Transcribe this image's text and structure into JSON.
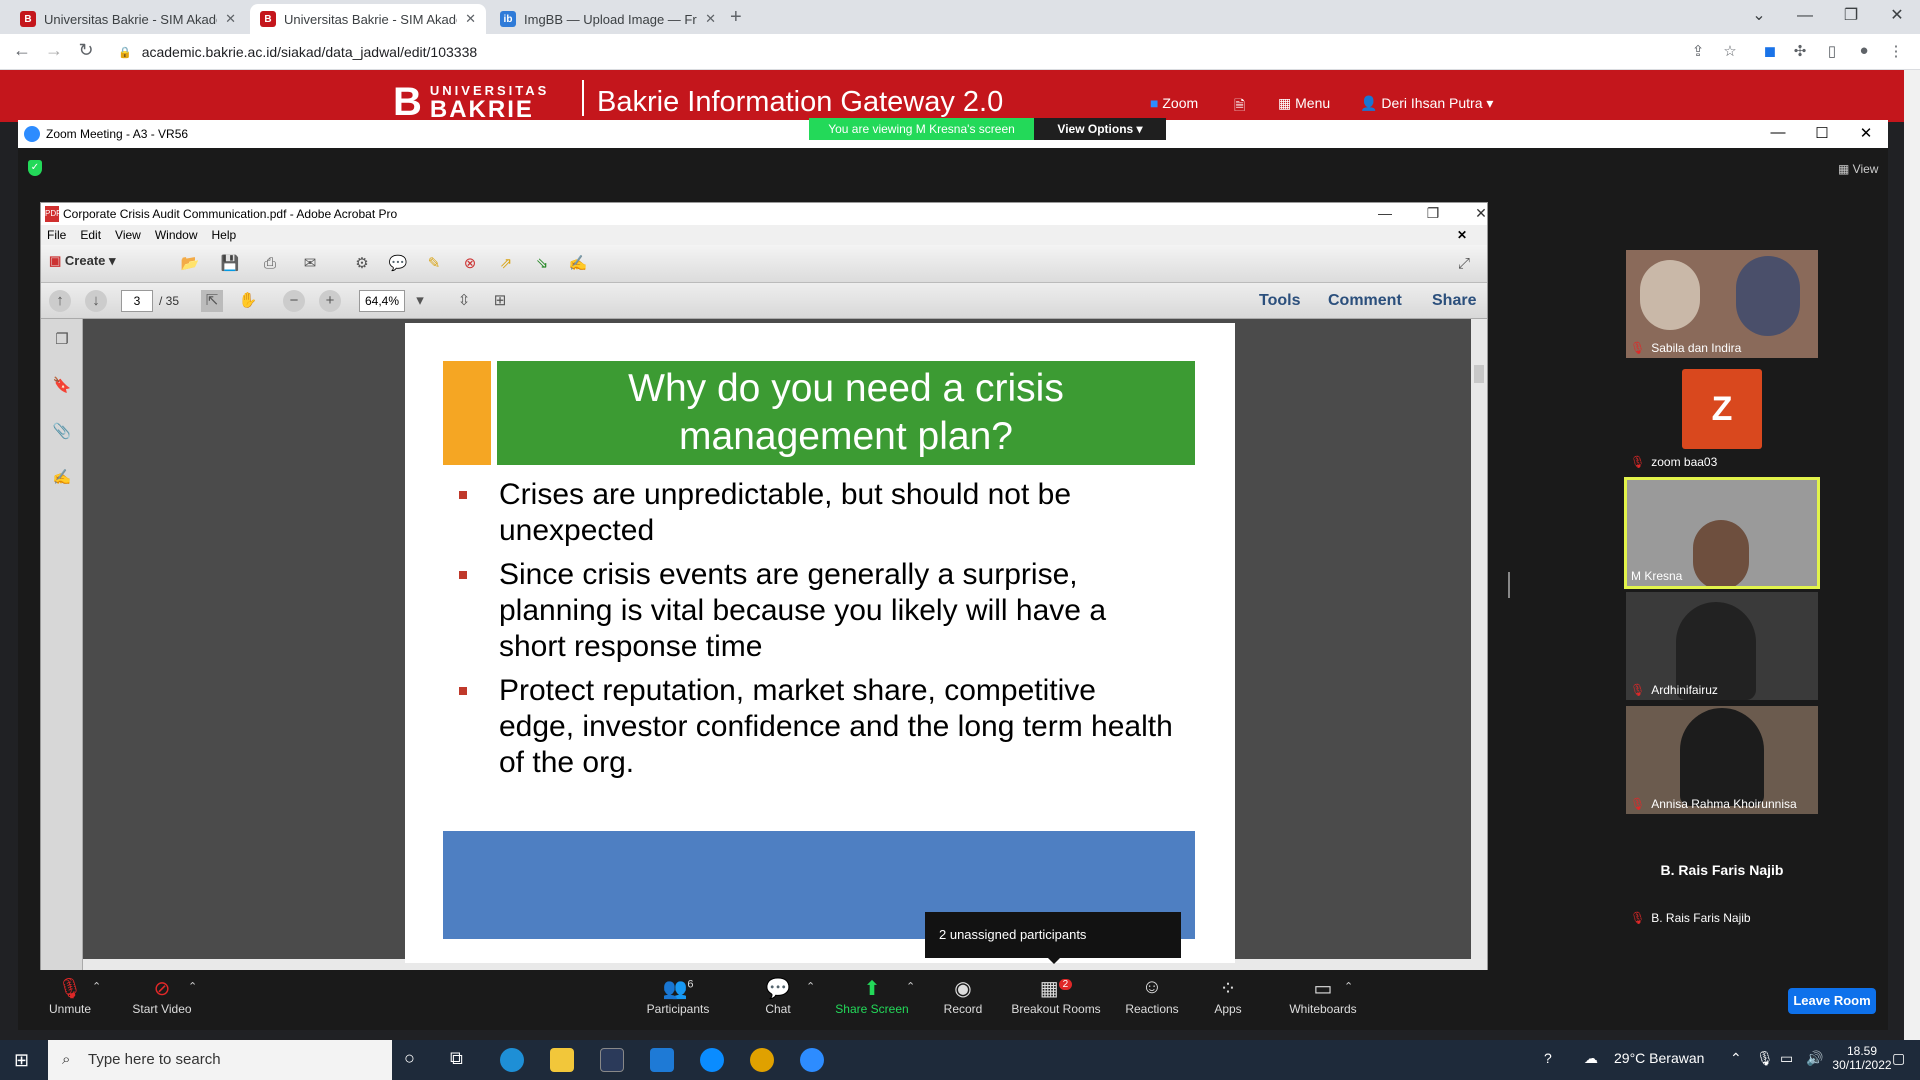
{
  "browser": {
    "tabs": [
      {
        "title": "Universitas Bakrie - SIM Akadem",
        "active": false
      },
      {
        "title": "Universitas Bakrie - SIM Akadem",
        "active": true
      },
      {
        "title": "ImgBB — Upload Image — Free",
        "active": false
      }
    ],
    "url": "academic.bakrie.ac.id/siakad/data_jadwal/edit/103338"
  },
  "site": {
    "logo_top": "UNIVERSITAS",
    "logo_bottom": "BAKRIE",
    "title": "Bakrie Information Gateway 2.0",
    "nav": {
      "zoom": "Zoom",
      "menu": "Menu",
      "user": "Deri Ihsan Putra"
    }
  },
  "zoom": {
    "window_title": "Zoom Meeting - A3 - VR56",
    "viewing_banner": "You are viewing M Kresna's screen",
    "view_options": "View Options",
    "view_label": "View",
    "tooltip": "2 unassigned participants",
    "participants": [
      {
        "name": "Sabila dan Indira",
        "kind": "video"
      },
      {
        "name": "zoom baa03",
        "kind": "avatar",
        "initial": "Z"
      },
      {
        "name": "M Kresna",
        "kind": "video",
        "active": true
      },
      {
        "name": "Ardhinifairuz",
        "kind": "video"
      },
      {
        "name": "Annisa Rahma Khoirunnisa",
        "kind": "video"
      },
      {
        "name": "B. Rais Faris Najib",
        "kind": "name",
        "display": "B. Rais Faris Najib"
      }
    ],
    "toolbar": {
      "unmute": "Unmute",
      "start_video": "Start Video",
      "participants": "Participants",
      "participants_count": "6",
      "chat": "Chat",
      "share_screen": "Share Screen",
      "record": "Record",
      "breakout_rooms": "Breakout Rooms",
      "breakout_badge": "2",
      "reactions": "Reactions",
      "apps": "Apps",
      "whiteboards": "Whiteboards",
      "leave_room": "Leave Room"
    }
  },
  "acrobat": {
    "title": "Corporate Crisis Audit Communication.pdf - Adobe Acrobat Pro",
    "menu": [
      "File",
      "Edit",
      "View",
      "Window",
      "Help"
    ],
    "create": "Create",
    "page": "3",
    "page_total": "/ 35",
    "zoom": "64,4%",
    "right_tabs": [
      "Tools",
      "Comment",
      "Share"
    ]
  },
  "slide": {
    "title_line1": "Why do you need a crisis",
    "title_line2": "management plan?",
    "bullets": [
      "Crises are unpredictable, but should not be unexpected",
      "Since crisis events are generally a surprise, planning is vital because you likely will have a short response time",
      "Protect reputation, market share, competitive edge, investor confidence and the long term health of the org."
    ]
  },
  "taskbar": {
    "search_placeholder": "Type here to search",
    "weather": "29°C  Berawan",
    "time": "18.59",
    "date": "30/11/2022"
  },
  "colors": {
    "bakrie_red": "#c4161c",
    "zoom_green": "#23d959",
    "leave_blue": "#0e71eb"
  }
}
